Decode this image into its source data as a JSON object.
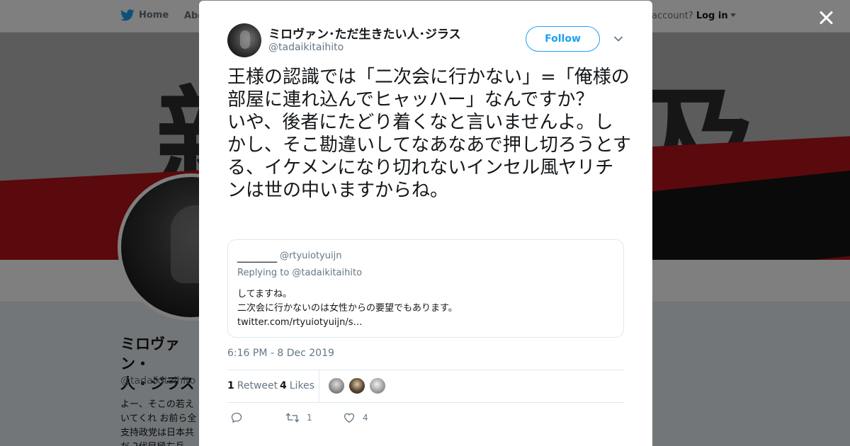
{
  "nav": {
    "home_label": "Home",
    "about_label": "Abo",
    "account_prompt": "account?",
    "login_label": "Log in"
  },
  "banner": {
    "glyph_left": "新",
    "glyph_right": "及"
  },
  "profile": {
    "name": "ミロヴァン・\n人・ジラス",
    "handle": "@tadaikitaihito",
    "bio": "よー、そこの若え\nいてくれ お前ら全\n支持政党は日本共\nだ 2代目極左兵"
  },
  "tweet": {
    "author_name": "ミロヴァン･ただ生きたい人･ジラス",
    "author_handle": "@tadaikitaihito",
    "follow_label": "Follow",
    "text": "王様の認識では「二次会に行かない」=「俺様の部屋に連れ込んでヒャッハー」なんですか？\nいや、後者にたどり着くなと言いませんよ。しかし、そこ勘違いしてなあなあで押し切ろうとする、イケメンになり切れないインセル風ヤリチンは世の中いますからね。",
    "quote": {
      "name": "＿＿＿＿",
      "handle": "@rtyuiotyuijn",
      "replying_to": "Replying to @tadaikitaihito",
      "body": "してますね。\n二次会に行かないのは女性からの要望でもあります。\ntwitter.com/rtyuiotyuijn/s…"
    },
    "timestamp": "6:16 PM - 8 Dec 2019",
    "retweet_count": "1",
    "retweet_label": "Retweet",
    "like_count": "4",
    "like_label": "Likes",
    "actions": {
      "reply_count": "",
      "retweet_count": "1",
      "like_count": "4"
    }
  },
  "colors": {
    "accent": "#1da1f2",
    "text": "#14171a",
    "muted": "#657786",
    "border": "#e1e8ed"
  },
  "icons": [
    "twitter-bird-icon",
    "chevron-down-icon",
    "close-icon",
    "reply-icon",
    "retweet-icon",
    "heart-icon"
  ]
}
